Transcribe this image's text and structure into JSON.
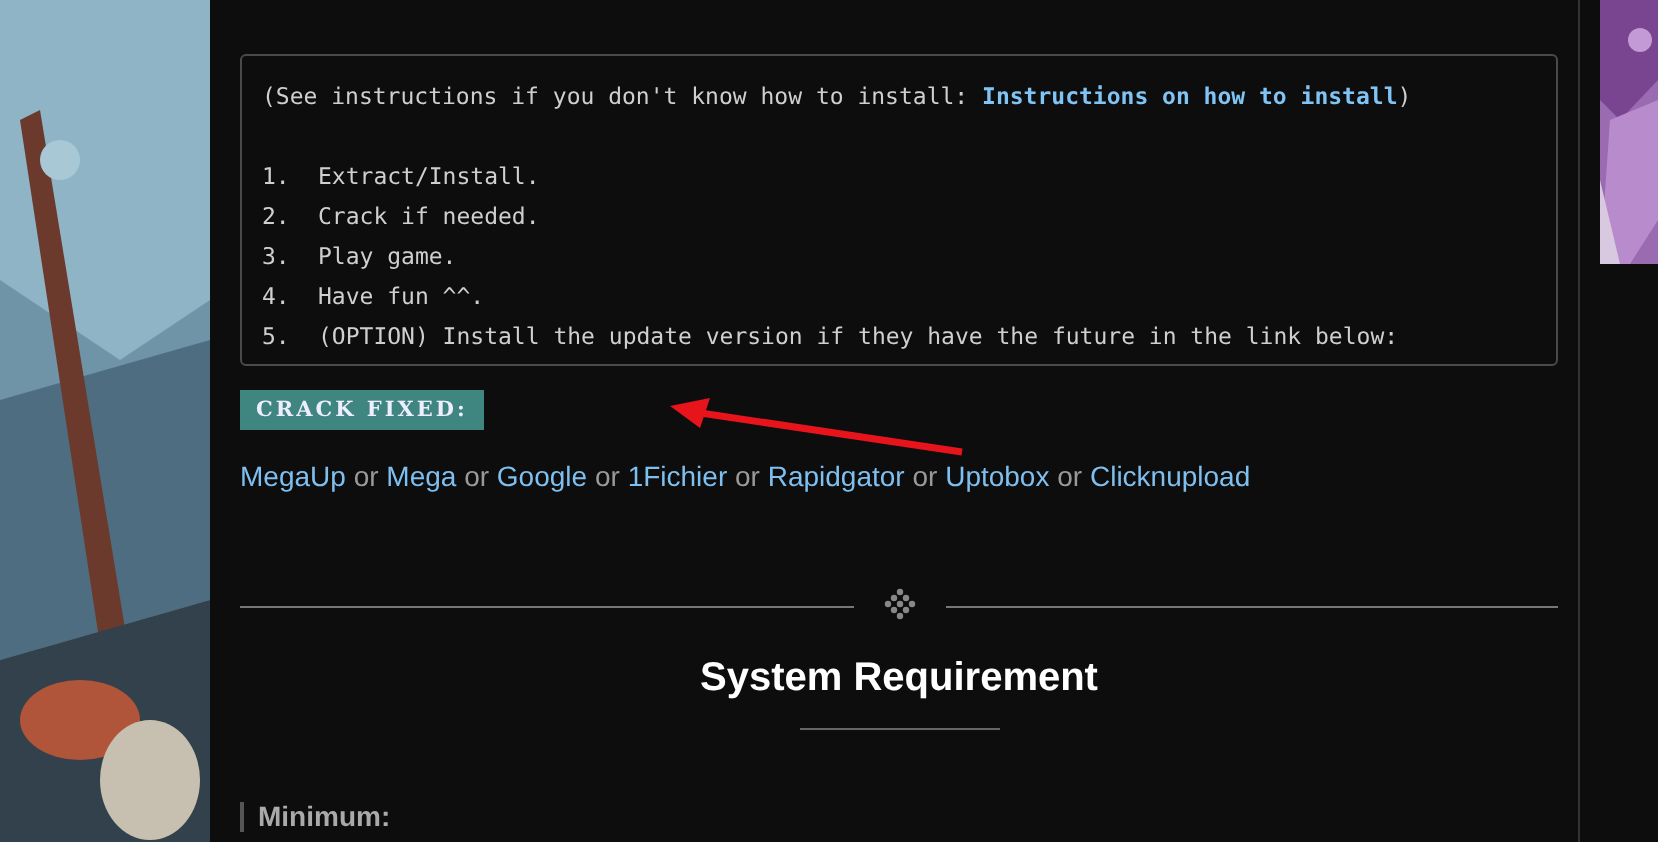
{
  "install_box": {
    "note_prefix": "(See instructions if you don't know how to install: ",
    "note_link": "Instructions on how to install",
    "note_suffix": ")",
    "steps": [
      {
        "number": "1.",
        "text": "Extract/Install."
      },
      {
        "number": "2.",
        "text": "Crack if needed."
      },
      {
        "number": "3.",
        "text": "Play game."
      },
      {
        "number": "4.",
        "text": "Have fun ^^."
      },
      {
        "number": "5.",
        "text": "(OPTION) Install the update version if they have the future in the link below:"
      }
    ]
  },
  "crack_label": "CRACK FIXED:",
  "download_links": [
    {
      "kind": "link",
      "text": "MegaUp"
    },
    {
      "kind": "text",
      "text": "or"
    },
    {
      "kind": "link",
      "text": "Mega"
    },
    {
      "kind": "text",
      "text": "or"
    },
    {
      "kind": "link",
      "text": "Google"
    },
    {
      "kind": "text",
      "text": "or"
    },
    {
      "kind": "link",
      "text": "1Fichier"
    },
    {
      "kind": "text",
      "text": "or"
    },
    {
      "kind": "link",
      "text": "Rapidgator"
    },
    {
      "kind": "text",
      "text": "or"
    },
    {
      "kind": "link",
      "text": "Uptobox"
    },
    {
      "kind": "text",
      "text": "or"
    },
    {
      "kind": "link",
      "text": "Clicknupload"
    }
  ],
  "section_title": "System Requirement",
  "minimum_label": "Minimum:"
}
